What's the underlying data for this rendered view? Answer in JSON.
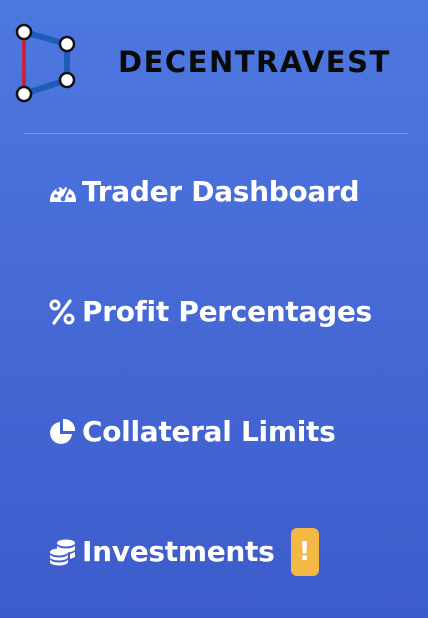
{
  "brand": {
    "name": "DECENTRAVEST",
    "logo_icon": "decentravest-logo-icon"
  },
  "nav": {
    "items": [
      {
        "label": "Trader Dashboard",
        "icon": "tachometer-icon"
      },
      {
        "label": "Profit Percentages",
        "icon": "percent-icon"
      },
      {
        "label": "Collateral Limits",
        "icon": "pie-chart-icon"
      },
      {
        "label": "Investments",
        "icon": "coins-icon",
        "badge": "!"
      }
    ]
  },
  "colors": {
    "background_top": "#4d78e0",
    "background_bottom": "#3d5ccc",
    "text": "#ffffff",
    "brand_text": "#0a0a0a",
    "badge": "#f4b844",
    "logo_blue": "#1f5bb8",
    "logo_red": "#c8233a"
  }
}
